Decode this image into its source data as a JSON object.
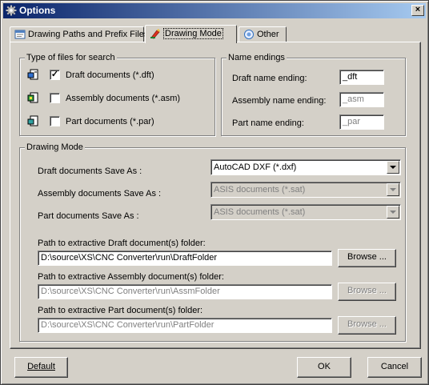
{
  "window": {
    "title": "Options",
    "close_label": "×"
  },
  "tabs": [
    {
      "label": "Drawing Paths and Prefix Files",
      "icon": "paths-icon",
      "active": false
    },
    {
      "label": "Drawing Mode",
      "icon": "drawing-mode-icon",
      "active": true
    },
    {
      "label": "Other",
      "icon": "other-icon",
      "active": false
    }
  ],
  "file_types": {
    "title": "Type of files for search",
    "items": [
      {
        "label": "Draft documents (*.dft)",
        "checked": true,
        "icon": "draft-file-icon"
      },
      {
        "label": "Assembly documents (*.asm)",
        "checked": false,
        "icon": "assembly-file-icon"
      },
      {
        "label": "Part documents (*.par)",
        "checked": false,
        "icon": "part-file-icon"
      }
    ]
  },
  "name_endings": {
    "title": "Name endings",
    "draft_label": "Draft name ending:",
    "draft_value": "_dft",
    "assembly_label": "Assembly name ending:",
    "assembly_value": "_asm",
    "part_label": "Part name ending:",
    "part_value": "_par"
  },
  "drawing_mode": {
    "title": "Drawing Mode",
    "draft_saveas_label": "Draft documents Save As :",
    "draft_saveas_value": "AutoCAD DXF (*.dxf)",
    "assembly_saveas_label": "Assembly documents Save As :",
    "assembly_saveas_value": "ASIS documents (*.sat)",
    "part_saveas_label": "Part documents Save As :",
    "part_saveas_value": "ASIS documents (*.sat)",
    "draft_path_label": "Path to extractive Draft document(s) folder:",
    "draft_path_value": "D:\\source\\XS\\CNC Converter\\run\\DraftFolder",
    "assembly_path_label": "Path to extractive Assembly document(s) folder:",
    "assembly_path_value": "D:\\source\\XS\\CNC Converter\\run\\AssmFolder",
    "part_path_label": "Path to extractive Part document(s) folder:",
    "part_path_value": "D:\\source\\XS\\CNC Converter\\run\\PartFolder",
    "browse_label": "Browse ..."
  },
  "footer": {
    "default_label": "Default",
    "ok_label": "OK",
    "cancel_label": "Cancel"
  }
}
